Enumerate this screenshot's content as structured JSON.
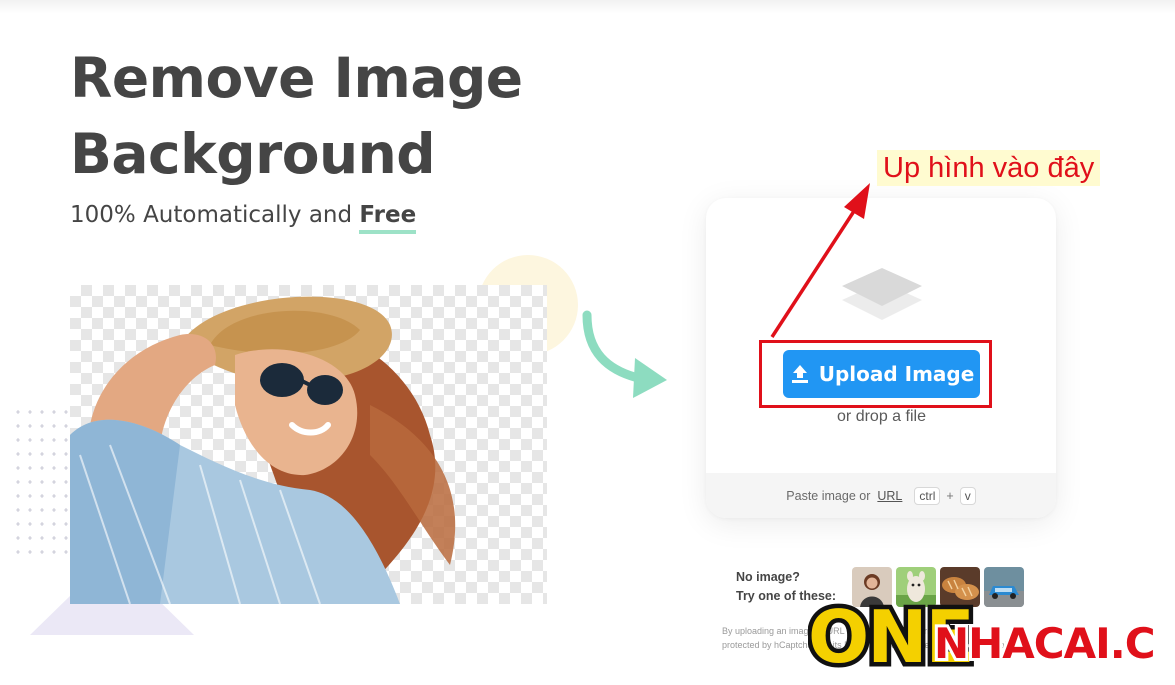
{
  "hero": {
    "title_line1": "Remove Image",
    "title_line2": "Background",
    "subtitle_prefix": "100% Automatically and ",
    "subtitle_free": "Free"
  },
  "upload": {
    "button_label": "Upload Image",
    "drop_text": "or drop a file",
    "paste_prefix": "Paste image or",
    "paste_url": "URL",
    "key_ctrl": "ctrl",
    "key_plus": "+",
    "key_v": "v"
  },
  "annotation": {
    "text": "Up hình vào đây",
    "color": "#e0101a"
  },
  "samples": {
    "line1": "No image?",
    "line2": "Try one of these:",
    "thumbnails": [
      "woman-thumbnail",
      "llama-thumbnail",
      "bread-thumbnail",
      "car-thumbnail"
    ]
  },
  "disclaimer": {
    "line1": "By uploading an image or URL you agree to our Terms of Service",
    "line2": "protected by hCaptcha and its Privacy Policy and Terms of Service apply."
  },
  "watermark": {
    "brand_one": "ONE",
    "brand_rest": "NHACAI.COM"
  },
  "colors": {
    "accent_blue": "#2196f3",
    "accent_green": "#9de2c7",
    "text_dark": "#454545",
    "annotation_red": "#e0101a"
  }
}
